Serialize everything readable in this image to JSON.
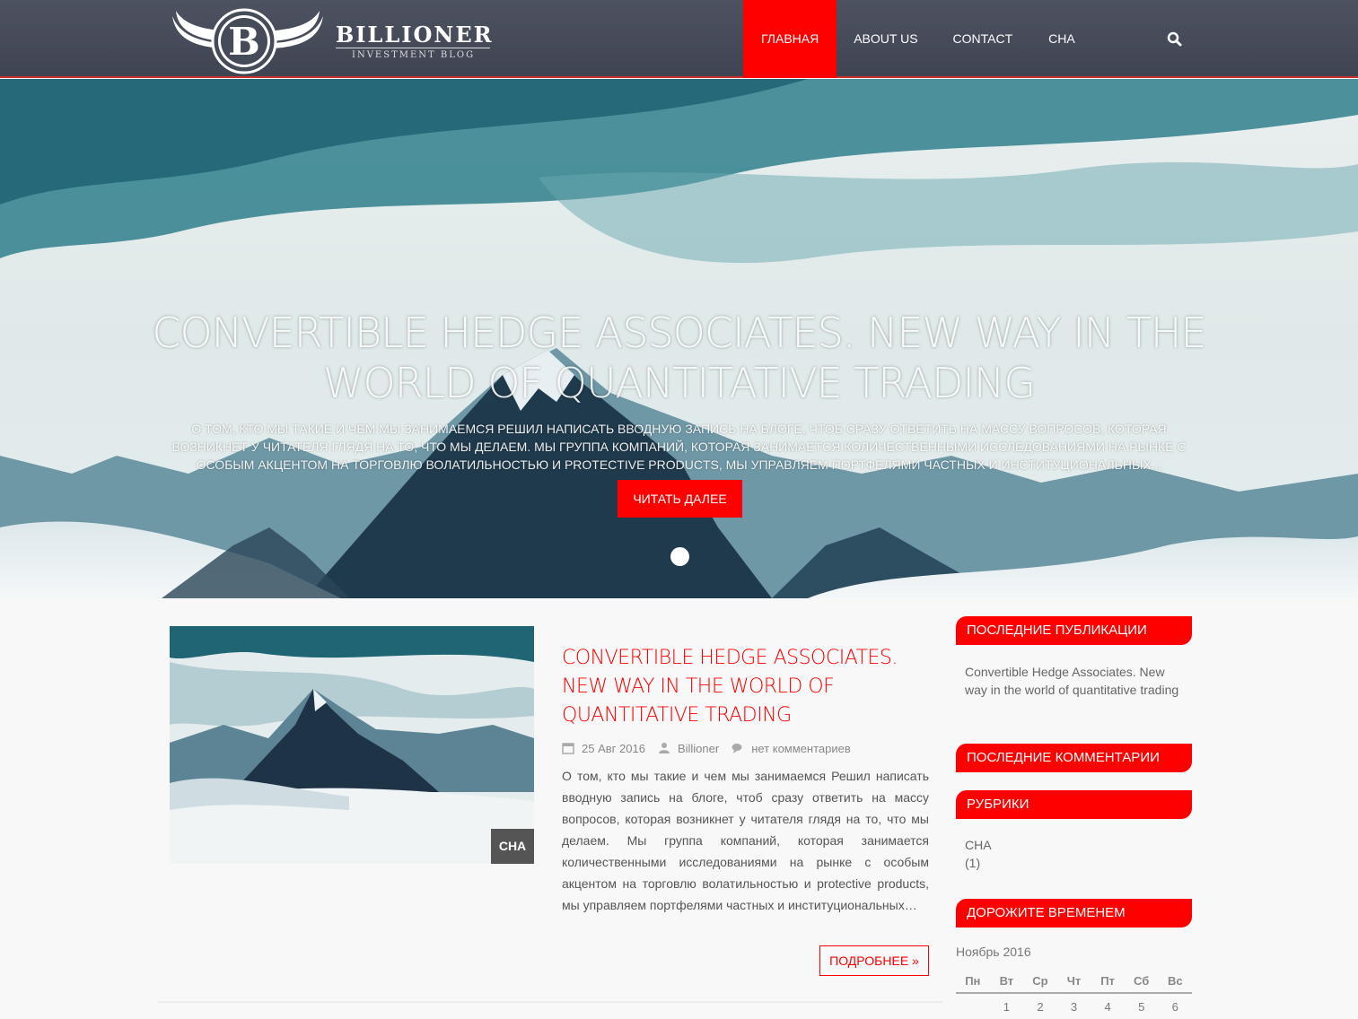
{
  "brand": {
    "name": "BILLIONER",
    "tagline": "INVESTMENT BLOG",
    "letter": "B"
  },
  "nav": {
    "items": [
      {
        "label": "ГЛАВНАЯ"
      },
      {
        "label": "ABOUT US"
      },
      {
        "label": "CONTACT"
      },
      {
        "label": "CHA"
      }
    ],
    "search_icon": "search-icon"
  },
  "hero": {
    "title": "CONVERTIBLE HEDGE ASSOCIATES. NEW WAY IN THE WORLD OF QUANTITATIVE TRADING",
    "excerpt": "О том, кто мы такие и чем мы занимаемся Решил написать вводную запись на блоге, чтоб сразу ответить на массу вопросов, которая возникнет у читателя глядя на то, что мы делаем. Мы группа компаний, которая занимается количественными исследованиями на рынке с особым акцентом на торговлю волатильностью и protective products, мы управляем портфелями частных и институциональных...",
    "button": "ЧИТАТЬ ДАЛЕЕ"
  },
  "post": {
    "category": "CHA",
    "title": "CONVERTIBLE HEDGE ASSOCIATES. NEW WAY IN THE WORLD OF QUANTITATIVE TRADING",
    "date": "25 Авг 2016",
    "author": "Billioner",
    "comments": "нет комментариев",
    "excerpt": "О том, кто мы такие и чем мы занимаемся Решил написать вводную запись на блоге, чтоб сразу ответить на массу вопросов, которая возникнет у читателя глядя на то, что мы делаем. Мы группа компаний, которая занимается количественными исследованиями на рынке с особым акцентом на торговлю волатильностью и protective products, мы управляем портфелями частных и институциональных…",
    "more": "ПОДРОБНЕЕ »"
  },
  "sidebar": {
    "recent_posts": {
      "title": "ПОСЛЕДНИЕ ПУБЛИКАЦИИ",
      "items": [
        "Convertible Hedge Associates. New way in the world of quantitative trading"
      ]
    },
    "recent_comments": {
      "title": "ПОСЛЕДНИЕ КОММЕНТАРИИ"
    },
    "categories": {
      "title": "РУБРИКИ",
      "items": [
        {
          "name": "CHA",
          "count": "(1)"
        }
      ]
    },
    "calendar": {
      "title": "ДОРОЖИТЕ ВРЕМЕНЕМ",
      "caption": "Ноябрь 2016",
      "days": [
        "Пн",
        "Вт",
        "Ср",
        "Чт",
        "Пт",
        "Сб",
        "Вс"
      ],
      "first_row": [
        "",
        "1",
        "2",
        "3",
        "4",
        "5",
        "6"
      ]
    }
  },
  "colors": {
    "accent": "#ff0000",
    "header": "#464b59",
    "text": "#555555"
  }
}
